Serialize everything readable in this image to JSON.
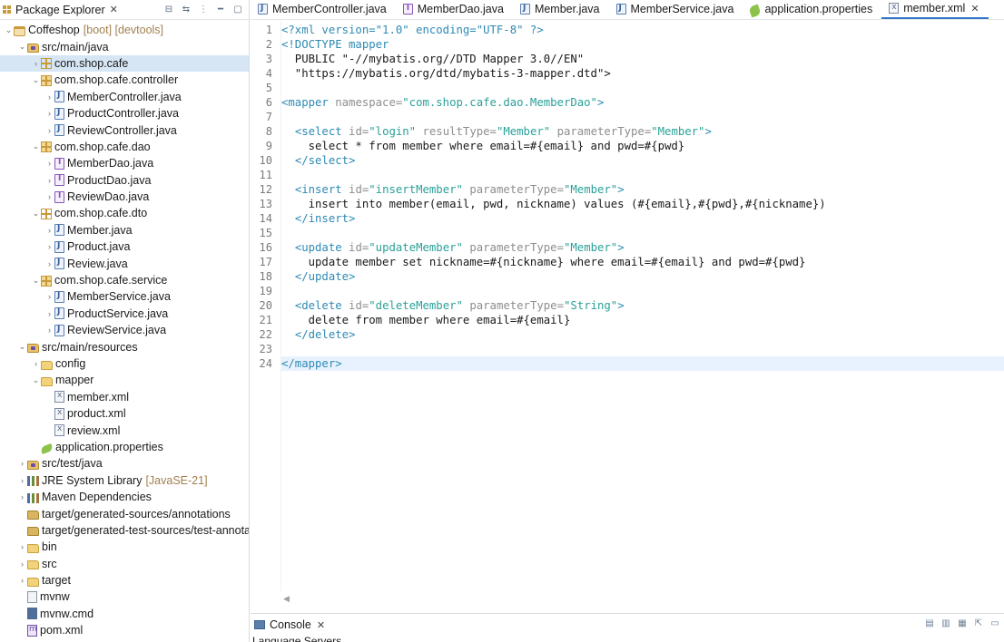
{
  "explorer": {
    "title": "Package Explorer",
    "tree": [
      {
        "depth": 0,
        "twisty": "open",
        "icon": "project",
        "label": "Coffeshop",
        "deco": "[boot] [devtools]"
      },
      {
        "depth": 1,
        "twisty": "open",
        "icon": "srcfolder",
        "label": "src/main/java"
      },
      {
        "depth": 2,
        "twisty": "closed",
        "icon": "package",
        "label": "com.shop.cafe",
        "selected": true
      },
      {
        "depth": 2,
        "twisty": "open",
        "icon": "package-colored",
        "label": "com.shop.cafe.controller"
      },
      {
        "depth": 3,
        "twisty": "closed",
        "icon": "java",
        "label": "MemberController.java"
      },
      {
        "depth": 3,
        "twisty": "closed",
        "icon": "java",
        "label": "ProductController.java"
      },
      {
        "depth": 3,
        "twisty": "closed",
        "icon": "java",
        "label": "ReviewController.java"
      },
      {
        "depth": 2,
        "twisty": "open",
        "icon": "package-colored",
        "label": "com.shop.cafe.dao"
      },
      {
        "depth": 3,
        "twisty": "closed",
        "icon": "java-interface",
        "label": "MemberDao.java"
      },
      {
        "depth": 3,
        "twisty": "closed",
        "icon": "java-interface",
        "label": "ProductDao.java"
      },
      {
        "depth": 3,
        "twisty": "closed",
        "icon": "java-interface",
        "label": "ReviewDao.java"
      },
      {
        "depth": 2,
        "twisty": "open",
        "icon": "package",
        "label": "com.shop.cafe.dto"
      },
      {
        "depth": 3,
        "twisty": "closed",
        "icon": "java",
        "label": "Member.java"
      },
      {
        "depth": 3,
        "twisty": "closed",
        "icon": "java",
        "label": "Product.java"
      },
      {
        "depth": 3,
        "twisty": "closed",
        "icon": "java",
        "label": "Review.java"
      },
      {
        "depth": 2,
        "twisty": "open",
        "icon": "package-colored",
        "label": "com.shop.cafe.service"
      },
      {
        "depth": 3,
        "twisty": "closed",
        "icon": "java",
        "label": "MemberService.java"
      },
      {
        "depth": 3,
        "twisty": "closed",
        "icon": "java",
        "label": "ProductService.java"
      },
      {
        "depth": 3,
        "twisty": "closed",
        "icon": "java",
        "label": "ReviewService.java"
      },
      {
        "depth": 1,
        "twisty": "open",
        "icon": "srcfolder",
        "label": "src/main/resources"
      },
      {
        "depth": 2,
        "twisty": "closed",
        "icon": "folder",
        "label": "config"
      },
      {
        "depth": 2,
        "twisty": "open",
        "icon": "folder",
        "label": "mapper"
      },
      {
        "depth": 3,
        "twisty": "none",
        "icon": "xml",
        "label": "member.xml"
      },
      {
        "depth": 3,
        "twisty": "none",
        "icon": "xml",
        "label": "product.xml"
      },
      {
        "depth": 3,
        "twisty": "none",
        "icon": "xml",
        "label": "review.xml"
      },
      {
        "depth": 2,
        "twisty": "none",
        "icon": "properties",
        "label": "application.properties"
      },
      {
        "depth": 1,
        "twisty": "closed",
        "icon": "srcfolder",
        "label": "src/test/java"
      },
      {
        "depth": 1,
        "twisty": "closed",
        "icon": "library",
        "label": "JRE System Library",
        "deco": "[JavaSE-21]"
      },
      {
        "depth": 1,
        "twisty": "closed",
        "icon": "library",
        "label": "Maven Dependencies"
      },
      {
        "depth": 1,
        "twisty": "none",
        "icon": "generated",
        "label": "target/generated-sources/annotations"
      },
      {
        "depth": 1,
        "twisty": "none",
        "icon": "generated",
        "label": "target/generated-test-sources/test-annota"
      },
      {
        "depth": 1,
        "twisty": "closed",
        "icon": "folder",
        "label": "bin"
      },
      {
        "depth": 1,
        "twisty": "closed",
        "icon": "folder",
        "label": "src"
      },
      {
        "depth": 1,
        "twisty": "closed",
        "icon": "folder",
        "label": "target"
      },
      {
        "depth": 1,
        "twisty": "none",
        "icon": "file",
        "label": "mvnw"
      },
      {
        "depth": 1,
        "twisty": "none",
        "icon": "cmd",
        "label": "mvnw.cmd"
      },
      {
        "depth": 1,
        "twisty": "none",
        "icon": "pom",
        "label": "pom.xml"
      }
    ]
  },
  "tabs": [
    {
      "label": "MemberController.java",
      "icon": "java",
      "active": false
    },
    {
      "label": "MemberDao.java",
      "icon": "java-interface",
      "active": false
    },
    {
      "label": "Member.java",
      "icon": "java",
      "active": false
    },
    {
      "label": "MemberService.java",
      "icon": "java",
      "active": false
    },
    {
      "label": "application.properties",
      "icon": "properties",
      "active": false
    },
    {
      "label": "member.xml",
      "icon": "xml",
      "active": true
    }
  ],
  "editor": {
    "current_line": 24,
    "lines": [
      [
        [
          "pi",
          "<?xml version=\"1.0\" encoding=\"UTF-8\" ?>"
        ]
      ],
      [
        [
          "tag",
          "<!DOCTYPE mapper"
        ]
      ],
      [
        [
          "text",
          "  PUBLIC \"-//mybatis.org//DTD Mapper 3.0//EN\""
        ]
      ],
      [
        [
          "text",
          "  \"https://mybatis.org/dtd/mybatis-3-mapper.dtd\">"
        ]
      ],
      [],
      [
        [
          "tag",
          "<mapper"
        ],
        [
          "attr",
          " namespace="
        ],
        [
          "val",
          "\"com.shop.cafe.dao.MemberDao\""
        ],
        [
          "tag",
          ">"
        ]
      ],
      [],
      [
        [
          "text",
          "  "
        ],
        [
          "tag",
          "<select"
        ],
        [
          "attr",
          " id="
        ],
        [
          "val",
          "\"login\""
        ],
        [
          "attr",
          " resultType="
        ],
        [
          "val",
          "\"Member\""
        ],
        [
          "attr",
          " parameterType="
        ],
        [
          "val",
          "\"Member\""
        ],
        [
          "tag",
          ">"
        ]
      ],
      [
        [
          "text",
          "    select * from member where email=#{email} and pwd=#{pwd}"
        ]
      ],
      [
        [
          "text",
          "  "
        ],
        [
          "tag",
          "</select>"
        ]
      ],
      [],
      [
        [
          "text",
          "  "
        ],
        [
          "tag",
          "<insert"
        ],
        [
          "attr",
          " id="
        ],
        [
          "val",
          "\"insertMember\""
        ],
        [
          "attr",
          " parameterType="
        ],
        [
          "val",
          "\"Member\""
        ],
        [
          "tag",
          ">"
        ]
      ],
      [
        [
          "text",
          "    insert into member(email, pwd, nickname) values (#{email},#{pwd},#{nickname})"
        ]
      ],
      [
        [
          "text",
          "  "
        ],
        [
          "tag",
          "</insert>"
        ]
      ],
      [],
      [
        [
          "text",
          "  "
        ],
        [
          "tag",
          "<update"
        ],
        [
          "attr",
          " id="
        ],
        [
          "val",
          "\"updateMember\""
        ],
        [
          "attr",
          " parameterType="
        ],
        [
          "val",
          "\"Member\""
        ],
        [
          "tag",
          ">"
        ]
      ],
      [
        [
          "text",
          "    update member set nickname=#{nickname} where email=#{email} and pwd=#{pwd}"
        ]
      ],
      [
        [
          "text",
          "  "
        ],
        [
          "tag",
          "</update>"
        ]
      ],
      [],
      [
        [
          "text",
          "  "
        ],
        [
          "tag",
          "<delete"
        ],
        [
          "attr",
          " id="
        ],
        [
          "val",
          "\"deleteMember\""
        ],
        [
          "attr",
          " parameterType="
        ],
        [
          "val",
          "\"String\""
        ],
        [
          "tag",
          ">"
        ]
      ],
      [
        [
          "text",
          "    delete from member where email=#{email}"
        ]
      ],
      [
        [
          "text",
          "  "
        ],
        [
          "tag",
          "</delete>"
        ]
      ],
      [],
      [
        [
          "tag",
          "</mapper>"
        ]
      ]
    ]
  },
  "console": {
    "tab_label": "Console",
    "sub_label": "Language Servers"
  }
}
